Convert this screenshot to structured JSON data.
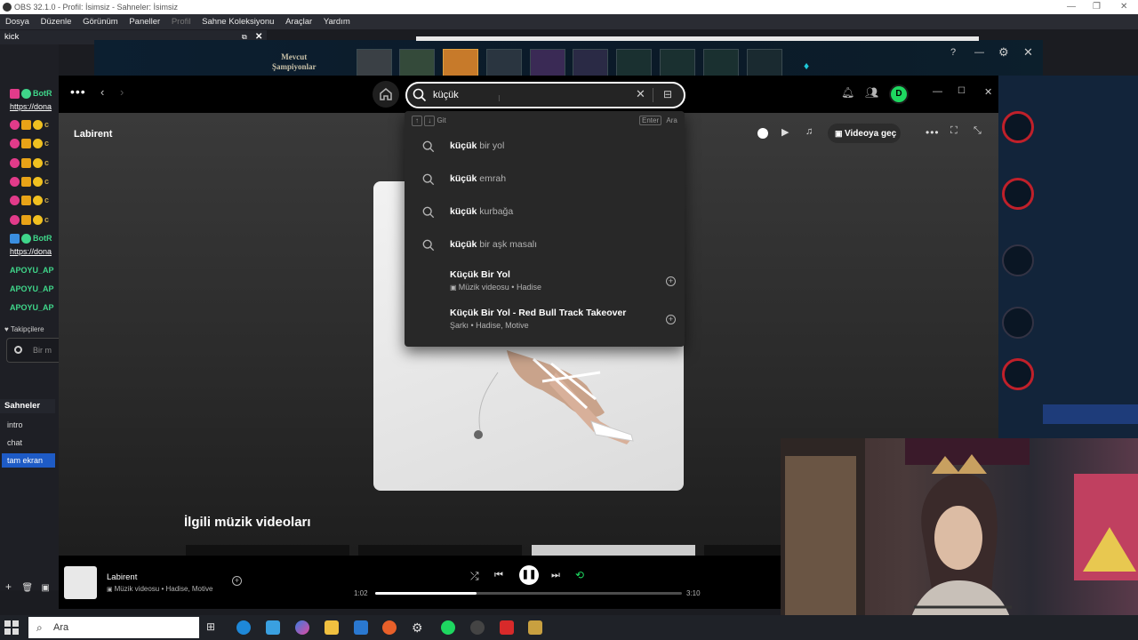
{
  "obs": {
    "title": "OBS 32.1.0 - Profil: İsimsiz - Sahneler: İsimsiz",
    "menu": [
      "Dosya",
      "Düzenle",
      "Görünüm",
      "Paneller",
      "Profil",
      "Sahne Koleksiyonu",
      "Araçlar",
      "Yardım"
    ],
    "dock_title": "kick",
    "scenes_title": "Sahneler",
    "scenes": [
      "intro",
      "chat",
      "tam ekran"
    ],
    "selected_scene": "tam ekran"
  },
  "chat": {
    "lines": [
      {
        "text": "BotR"
      },
      {
        "text": "https://dona"
      },
      {
        "text": "c"
      },
      {
        "text": "c"
      },
      {
        "text": "c"
      },
      {
        "text": "c"
      },
      {
        "text": "c"
      },
      {
        "text": "c"
      },
      {
        "text": "BotR"
      },
      {
        "text": "https://dona"
      },
      {
        "text": "APOYU_AP"
      },
      {
        "text": "APOYU_AP"
      },
      {
        "text": "APOYU_AP"
      }
    ],
    "followers_label": "Takipçilere",
    "message_placeholder": "Bir m"
  },
  "game": {
    "label_line1": "Mevcut",
    "label_line2": "Şampiyonlar"
  },
  "spotify": {
    "page_title": "Labirent",
    "search": {
      "value": "küçük"
    },
    "dropdown": {
      "hint_go": "Git",
      "hint_enter": "Enter",
      "hint_search": "Ara",
      "suggestions": [
        {
          "bold": "küçük",
          "rest": " bir yol"
        },
        {
          "bold": "küçük",
          "rest": " emrah"
        },
        {
          "bold": "küçük",
          "rest": " kurbağa"
        },
        {
          "bold": "küçük",
          "rest": " bir aşk masalı"
        }
      ],
      "results": [
        {
          "title": "Küçük Bir Yol",
          "subtitle": "Müzik videosu • Hadise"
        },
        {
          "title": "Küçük Bir Yol - Red Bull Track Takeover",
          "subtitle": "Şarkı • Hadise, Motive"
        }
      ]
    },
    "switch_video": "Videoya geç",
    "avatar_letter": "D",
    "related_heading": "İlgili müzik videoları",
    "player": {
      "track_title": "Labirent",
      "track_subtitle": "Müzik videosu • Hadise, Motive",
      "elapsed": "1:02",
      "duration": "3:10",
      "progress": 0.33
    }
  },
  "taskbar": {
    "search_placeholder": "Ara"
  },
  "colors": {
    "spotify_green": "#1ed760",
    "obs_select": "#1e5bc6"
  }
}
